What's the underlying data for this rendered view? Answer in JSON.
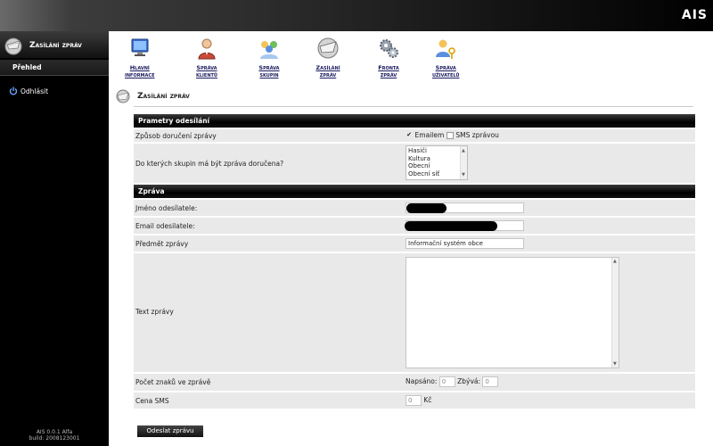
{
  "app": {
    "brand": "AIS"
  },
  "sidebar": {
    "title": "Zasílání zpráv",
    "overview": "Přehled",
    "logout": "Odhlásit",
    "version": "AIS 0.0.1 Alfa",
    "build": "build: 2008123001"
  },
  "nav": {
    "items": [
      {
        "label": "Hlavní informace",
        "icon": "monitor-icon"
      },
      {
        "label": "Správa klientů",
        "icon": "user-icon"
      },
      {
        "label": "Správa skupin",
        "icon": "group-icon"
      },
      {
        "label": "Zasílání zpráv",
        "icon": "message-icon"
      },
      {
        "label": "Fronta zpráv",
        "icon": "gears-icon"
      },
      {
        "label": "Správa uživatelů",
        "icon": "users-key-icon"
      }
    ]
  },
  "page": {
    "title": "Zasílání zpráv"
  },
  "form": {
    "section1": "Prametry odesílání",
    "delivery_label": "Způsob doručení zprávy",
    "opt_email": "Emailem",
    "opt_sms": "SMS zprávou",
    "email_checked": true,
    "sms_checked": false,
    "groups_label": "Do kterých skupin má být zpráva doručena?",
    "groups": [
      "Hasiči",
      "Kultura",
      "Obecní",
      "Obecní síť"
    ],
    "section2": "Zpráva",
    "sender_name_label": "Jméno odesílatele:",
    "sender_email_label": "Email odesilatele:",
    "subject_label": "Předmět zprávy",
    "subject_value": "Informační systém obce",
    "text_label": "Text zprávy",
    "charcount_label": "Počet znaků ve zprávě",
    "written_label": "Napsáno:",
    "written_value": "0",
    "remaining_label": "Zbývá:",
    "remaining_value": "0",
    "sms_price_label": "Cena SMS",
    "sms_price_value": "0",
    "currency": "Kč",
    "send_button": "Odeslat zprávu"
  },
  "colors": {
    "header_dark": "#000000",
    "row_bg": "#e9e9e9",
    "nav_link": "#1a1a60"
  }
}
